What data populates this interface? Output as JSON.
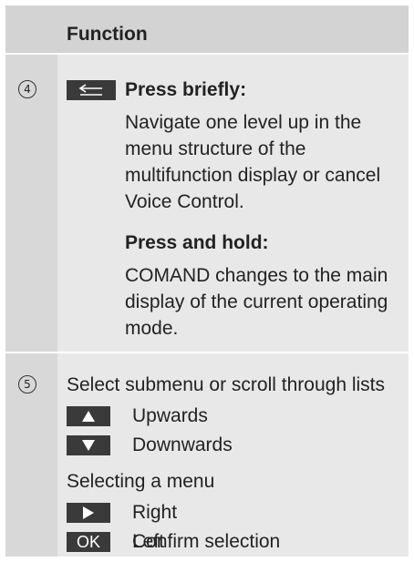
{
  "header": {
    "title": "Function"
  },
  "row4": {
    "number": "4",
    "key_icon": "back-arrow-icon",
    "press_briefly_label": "Press briefly:",
    "press_briefly_text": "Navigate one level up in the menu structure of the multifunction display or cancel Voice Control.",
    "press_hold_label": "Press and hold:",
    "press_hold_text": "COMAND changes to the main display of the current operating mode."
  },
  "row5": {
    "number": "5",
    "intro": "Select submenu or scroll through lists",
    "up_label": "Upwards",
    "down_label": "Downwards",
    "menu_intro": "Selecting a menu",
    "right_label": "Right",
    "left_label": "Left",
    "ok_key": "OK",
    "confirm_label": "Confirm selection"
  }
}
